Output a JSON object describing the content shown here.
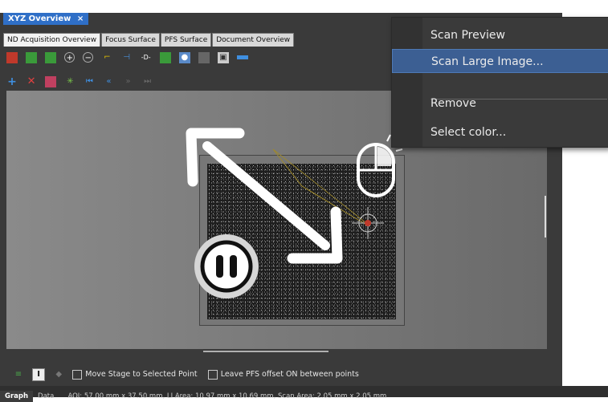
{
  "window": {
    "title_tab": "XYZ Overview",
    "close_glyph": "×"
  },
  "tabs": [
    {
      "label": "ND Acquisition Overview",
      "active": true
    },
    {
      "label": "Focus Surface"
    },
    {
      "label": "PFS Surface"
    },
    {
      "label": "Document Overview"
    }
  ],
  "context_menu": {
    "items": [
      "Scan Preview",
      "Scan Large Image...",
      "Remove",
      "Select color..."
    ],
    "highlighted": "Scan Large Image..."
  },
  "bottom_options": {
    "move_stage": "Move Stage to Selected Point",
    "leave_pfs": "Leave PFS offset ON between points"
  },
  "statusbar": {
    "tab_graph": "Graph",
    "tab_data": "Data",
    "info": "AOI: 57.00 mm x 37.50 mm, LI Area: 10.97 mm x 10.69 mm, Scan Area: 2.05 mm x 2.05 mm"
  },
  "colors": {
    "accent": "#2f6fc7",
    "menu_highlight": "#3c5f93",
    "panel": "#3a3a3a"
  }
}
